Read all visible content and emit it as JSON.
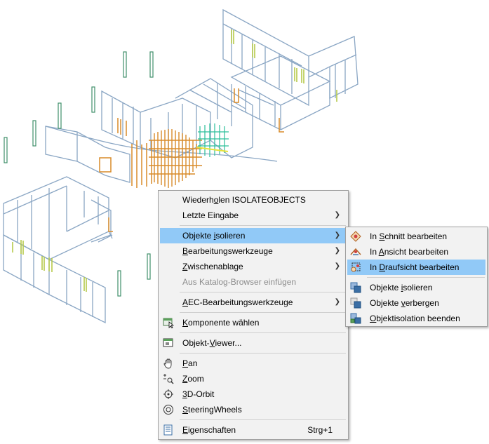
{
  "main_menu": {
    "items": [
      {
        "pre": "Wiederh",
        "key": "o",
        "post": "len ISOLATEOBJECTS"
      },
      {
        "pre": "Letzte Eingabe",
        "key": "",
        "post": ""
      },
      {
        "pre": "Objekte ",
        "key": "i",
        "post": "solieren"
      },
      {
        "pre": "",
        "key": "B",
        "post": "earbeitungswerkzeuge"
      },
      {
        "pre": "",
        "key": "Z",
        "post": "wischenablage"
      },
      {
        "pre": "Aus Katalog-Browser einfügen",
        "key": "",
        "post": ""
      },
      {
        "pre": "",
        "key": "A",
        "post": "EC-Bearbeitungswerkzeuge"
      },
      {
        "pre": "",
        "key": "K",
        "post": "omponente wählen"
      },
      {
        "pre": "Objekt-",
        "key": "V",
        "post": "iewer..."
      },
      {
        "pre": "",
        "key": "P",
        "post": "an"
      },
      {
        "pre": "",
        "key": "Z",
        "post": "oom"
      },
      {
        "pre": "",
        "key": "3",
        "post": "D-Orbit"
      },
      {
        "pre": "",
        "key": "S",
        "post": "teeringWheels"
      },
      {
        "pre": "",
        "key": "E",
        "post": "igenschaften"
      }
    ],
    "properties_shortcut": "Strg+1"
  },
  "sub_menu": {
    "items": [
      {
        "pre": "In ",
        "key": "S",
        "post": "chnitt bearbeiten"
      },
      {
        "pre": "In ",
        "key": "A",
        "post": "nsicht bearbeiten"
      },
      {
        "pre": "In ",
        "key": "D",
        "post": "raufsicht bearbeiten"
      },
      {
        "pre": "Objekte ",
        "key": "i",
        "post": "solieren"
      },
      {
        "pre": "Objekte ",
        "key": "v",
        "post": "erbergen"
      },
      {
        "pre": "",
        "key": "O",
        "post": "bjektisolation beenden"
      }
    ]
  },
  "colors": {
    "highlight": "#91c9f7",
    "menu_bg": "#f2f2f2",
    "drawing_line": "#7f9fbf",
    "door_orange": "#d98c2a",
    "window_green": "#b5c94a",
    "post_green": "#3f8f6a"
  }
}
